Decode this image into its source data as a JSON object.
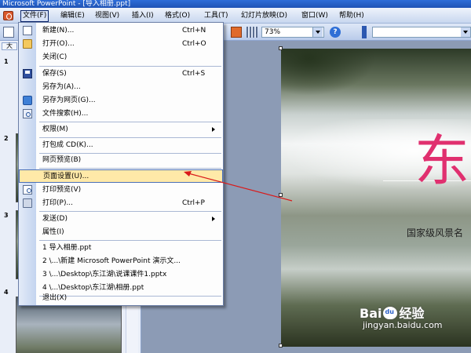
{
  "window": {
    "title": "Microsoft PowerPoint - [导入相册.ppt]"
  },
  "menubar": {
    "items": [
      {
        "label": "文件(F)"
      },
      {
        "label": "编辑(E)"
      },
      {
        "label": "视图(V)"
      },
      {
        "label": "插入(I)"
      },
      {
        "label": "格式(O)"
      },
      {
        "label": "工具(T)"
      },
      {
        "label": "幻灯片放映(D)"
      },
      {
        "label": "窗口(W)"
      },
      {
        "label": "帮助(H)"
      }
    ]
  },
  "toolbar": {
    "zoom": "73%"
  },
  "left_panel": {
    "tab_label": "大",
    "slide_numbers": [
      "1",
      "2",
      "3",
      "4"
    ]
  },
  "file_menu": {
    "items": [
      {
        "label": "新建(N)...",
        "shortcut": "Ctrl+N",
        "icon": "new-document-icon"
      },
      {
        "label": "打开(O)...",
        "shortcut": "Ctrl+O",
        "icon": "open-folder-icon"
      },
      {
        "label": "关闭(C)",
        "shortcut": ""
      },
      {
        "label": "保存(S)",
        "shortcut": "Ctrl+S",
        "icon": "save-icon"
      },
      {
        "label": "另存为(A)...",
        "shortcut": ""
      },
      {
        "label": "另存为网页(G)...",
        "shortcut": "",
        "icon": "web-page-icon"
      },
      {
        "label": "文件搜索(H)...",
        "shortcut": "",
        "icon": "file-search-icon"
      },
      {
        "label": "权限(M)",
        "shortcut": "",
        "submenu": true
      },
      {
        "label": "打包成 CD(K)...",
        "shortcut": ""
      },
      {
        "label": "网页预览(B)",
        "shortcut": ""
      },
      {
        "label": "页面设置(U)...",
        "shortcut": "",
        "highlighted": true
      },
      {
        "label": "打印预览(V)",
        "shortcut": "",
        "icon": "print-preview-icon"
      },
      {
        "label": "打印(P)...",
        "shortcut": "Ctrl+P",
        "icon": "print-icon"
      },
      {
        "label": "发送(D)",
        "shortcut": "",
        "submenu": true
      },
      {
        "label": "属性(I)",
        "shortcut": ""
      },
      {
        "label": "1 导入相册.ppt",
        "shortcut": ""
      },
      {
        "label": "2 \\...\\新建 Microsoft PowerPoint 演示文...",
        "shortcut": ""
      },
      {
        "label": "3 \\...\\Desktop\\东江湖\\说课课件1.pptx",
        "shortcut": ""
      },
      {
        "label": "4 \\...\\Desktop\\东江湖\\相册.ppt",
        "shortcut": ""
      },
      {
        "label": "退出(X)",
        "shortcut": ""
      }
    ]
  },
  "slide": {
    "title": "东",
    "subtitle": "国家级风景名"
  },
  "watermark": {
    "logo_left": "Bai",
    "logo_right": "经验",
    "url": "jingyan.baidu.com"
  },
  "colors": {
    "title_pink": "#e0306f",
    "highlight": "#ffe9a8",
    "arrow_red": "#d91a1a"
  }
}
